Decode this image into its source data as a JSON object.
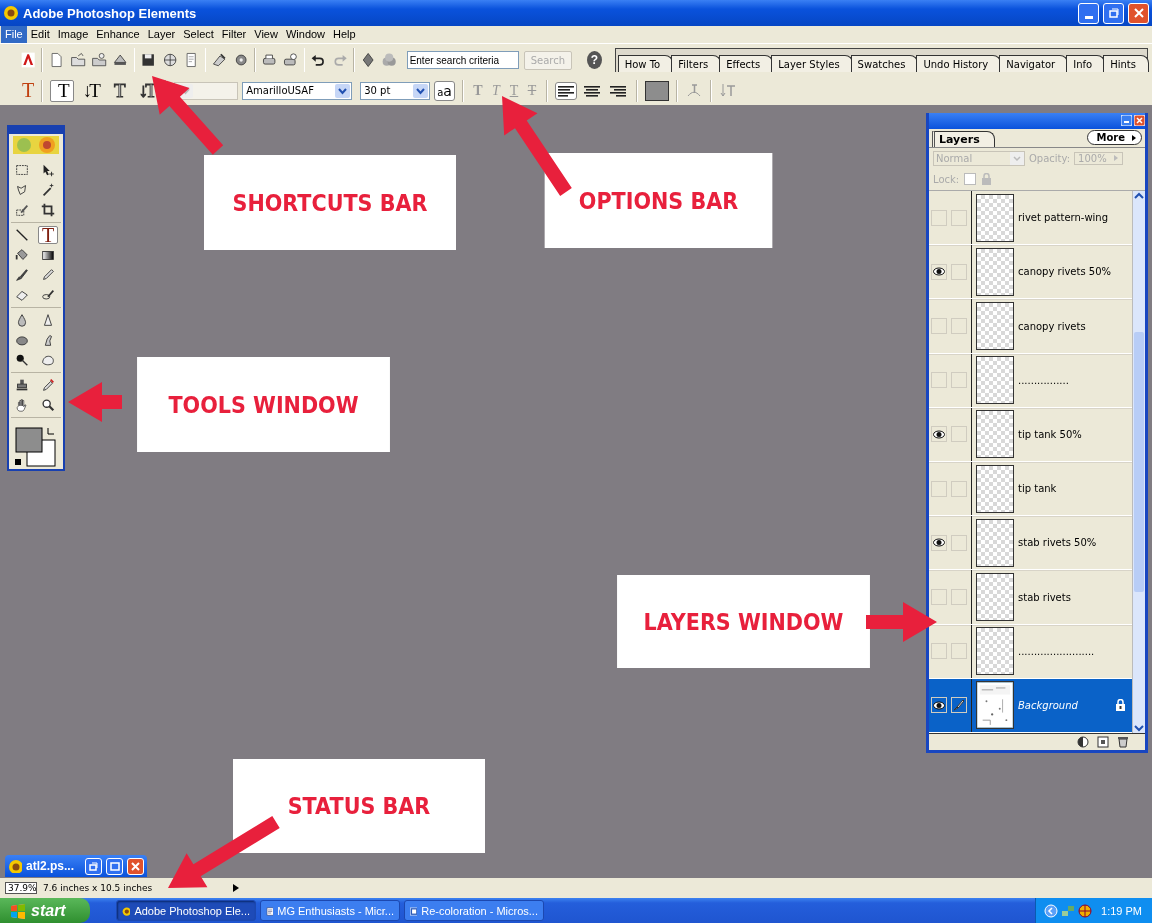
{
  "window": {
    "title": "Adobe Photoshop Elements"
  },
  "menu": [
    {
      "label": "File",
      "selected": true
    },
    {
      "label": "Edit",
      "selected": false
    },
    {
      "label": "Image",
      "selected": false
    },
    {
      "label": "Enhance",
      "selected": false
    },
    {
      "label": "Layer",
      "selected": false
    },
    {
      "label": "Select",
      "selected": false
    },
    {
      "label": "Filter",
      "selected": false
    },
    {
      "label": "View",
      "selected": false
    },
    {
      "label": "Window",
      "selected": false
    },
    {
      "label": "Help",
      "selected": false
    }
  ],
  "shortcuts_bar": {
    "search": {
      "placeholder": "Enter search criteria"
    },
    "search_button": "Search",
    "help_button": "?",
    "palette_tabs": [
      "How To",
      "Filters",
      "Effects",
      "Layer Styles",
      "Swatches",
      "Undo History",
      "Navigator",
      "Info",
      "Hints"
    ]
  },
  "options_bar": {
    "tool_glyph": "T",
    "type_tools": [
      {
        "glyph": "T",
        "kind": "plain",
        "selected": true
      },
      {
        "glyph": "↓T",
        "kind": "plain",
        "selected": false
      },
      {
        "glyph": "T",
        "kind": "mask",
        "selected": false
      },
      {
        "glyph": "↓T",
        "kind": "mask",
        "selected": false
      }
    ],
    "font_family": "AmarilloUSAF",
    "font_size": "30 pt",
    "anti_alias": "aa",
    "style_buttons": [
      {
        "glyph": "T",
        "kind": "bold"
      },
      {
        "glyph": "T",
        "kind": "italic"
      },
      {
        "glyph": "T",
        "kind": "underline"
      },
      {
        "glyph": "T",
        "kind": "strikethrough"
      }
    ],
    "align_buttons": [
      {
        "kind": "left",
        "selected": true
      },
      {
        "kind": "center",
        "selected": false
      },
      {
        "kind": "right",
        "selected": false
      }
    ]
  },
  "tools_window": {
    "tool_groups": [
      {
        "tools": [
          {
            "kind": "marquee",
            "selected": false
          },
          {
            "kind": "move",
            "selected": false
          },
          {
            "kind": "lasso",
            "selected": false
          },
          {
            "kind": "magic-wand",
            "selected": false
          },
          {
            "kind": "selection-brush",
            "selected": false
          },
          {
            "kind": "crop",
            "selected": false
          }
        ]
      },
      {
        "tools": [
          {
            "kind": "line",
            "selected": false
          },
          {
            "kind": "type",
            "glyph": "T",
            "selected": true
          },
          {
            "kind": "paint-bucket",
            "selected": false
          },
          {
            "kind": "gradient",
            "selected": false
          },
          {
            "kind": "brush",
            "selected": false
          },
          {
            "kind": "pencil",
            "selected": false
          },
          {
            "kind": "eraser",
            "selected": false
          },
          {
            "kind": "eye-brush",
            "selected": false
          }
        ]
      },
      {
        "tools": [
          {
            "kind": "blur",
            "selected": false
          },
          {
            "kind": "sharpen",
            "selected": false
          },
          {
            "kind": "sponge",
            "selected": false
          },
          {
            "kind": "smudge",
            "selected": false
          },
          {
            "kind": "burn",
            "selected": false
          },
          {
            "kind": "shape",
            "selected": false
          }
        ]
      },
      {
        "tools": [
          {
            "kind": "stamp",
            "selected": false
          },
          {
            "kind": "eyedropper",
            "selected": false
          },
          {
            "kind": "hand",
            "selected": false
          },
          {
            "kind": "zoom",
            "selected": false
          }
        ]
      }
    ]
  },
  "layers_window": {
    "tab": "Layers",
    "more_button": "More",
    "blend_mode": {
      "value": "Normal",
      "disabled": true
    },
    "opacity_label": "Opacity:",
    "opacity": "100%",
    "lock_label": "Lock:",
    "lock_transparency": {
      "checked": false
    },
    "layers": [
      {
        "name": "rivet pattern-wing",
        "kind": "transparent",
        "visible": false,
        "selected": false,
        "locked": false
      },
      {
        "name": "canopy rivets 50%",
        "kind": "transparent",
        "visible": true,
        "selected": false,
        "locked": false
      },
      {
        "name": "canopy rivets",
        "kind": "transparent",
        "visible": false,
        "selected": false,
        "locked": false
      },
      {
        "name": "................",
        "kind": "transparent",
        "visible": false,
        "selected": false,
        "locked": false
      },
      {
        "name": "tip tank 50%",
        "kind": "transparent",
        "visible": true,
        "selected": false,
        "locked": false
      },
      {
        "name": "tip tank",
        "kind": "transparent",
        "visible": false,
        "selected": false,
        "locked": false
      },
      {
        "name": "stab rivets 50%",
        "kind": "transparent",
        "visible": true,
        "selected": false,
        "locked": false
      },
      {
        "name": "stab rivets",
        "kind": "transparent",
        "visible": false,
        "selected": false,
        "locked": false
      },
      {
        "name": "........................",
        "kind": "transparent",
        "visible": false,
        "selected": false,
        "locked": false
      },
      {
        "name": "Background",
        "visible": true,
        "selected": true,
        "locked": true
      }
    ]
  },
  "document_window": {
    "title": "atl2.ps..."
  },
  "status_bar": {
    "zoom": "37.9%",
    "document_size": "7.6 inches x 10.5 inches"
  },
  "taskbar": {
    "start": "start",
    "tasks": [
      {
        "label": "Adobe Photoshop Ele...",
        "selected": true
      },
      {
        "label": "MG Enthusiasts - Micr...",
        "selected": false
      },
      {
        "label": "Re-coloration - Micros...",
        "selected": false
      }
    ],
    "clock": "1:19 PM"
  },
  "annotations": [
    {
      "text": "SHORTCUTS BAR"
    },
    {
      "text": "OPTIONS BAR"
    },
    {
      "text": "TOOLS WINDOW"
    },
    {
      "text": "LAYERS WINDOW"
    },
    {
      "text": "STATUS BAR"
    }
  ]
}
